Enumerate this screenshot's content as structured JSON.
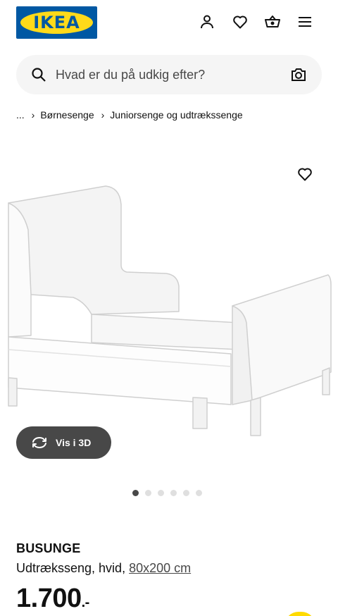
{
  "header": {
    "logo_text": "IKEA",
    "icons": [
      "user-icon",
      "heart-icon",
      "basket-icon",
      "menu-icon"
    ]
  },
  "search": {
    "placeholder": "Hvad er du på udkig efter?"
  },
  "breadcrumb": {
    "ellipsis": "...",
    "items": [
      "Børnesenge",
      "Juniorsenge og udtrækssenge"
    ]
  },
  "gallery": {
    "view_3d_label": "Vis i 3D",
    "dot_count": 6,
    "active_dot": 1
  },
  "product": {
    "name": "BUSUNGE",
    "description": "Udtræksseng, hvid,",
    "size": "80x200 cm",
    "price": "1.700",
    "price_suffix": ".-"
  },
  "colors": {
    "ikea_blue": "#0058a3",
    "ikea_yellow": "#ffda1a",
    "search_bg": "#f5f5f5",
    "button_dark": "#484848"
  }
}
